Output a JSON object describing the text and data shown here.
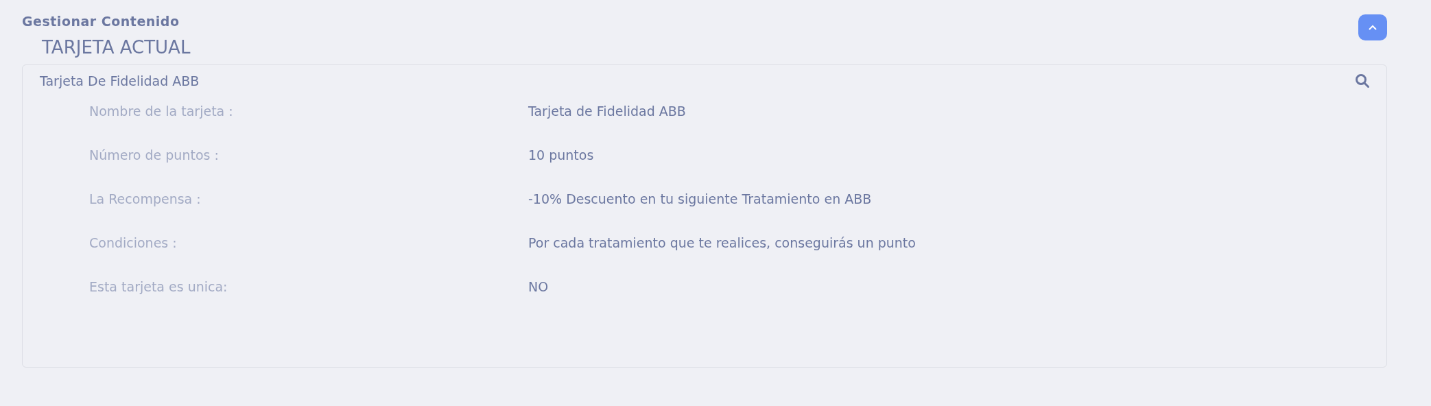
{
  "header": {
    "title": "Gestionar Contenido"
  },
  "section_title": "TARJETA ACTUAL",
  "card": {
    "title": "Tarjeta De Fidelidad ABB",
    "fields": [
      {
        "label": "Nombre de la tarjeta :",
        "value": "Tarjeta de Fidelidad ABB"
      },
      {
        "label": "Número de puntos :",
        "value": "10 puntos"
      },
      {
        "label": "La Recompensa :",
        "value": "-10% Descuento en tu siguiente Tratamiento en ABB"
      },
      {
        "label": "Condiciones :",
        "value": "Por cada tratamiento que te realices, conseguirás un punto"
      },
      {
        "label": "Esta tarjeta es unica:",
        "value": "NO"
      }
    ]
  }
}
